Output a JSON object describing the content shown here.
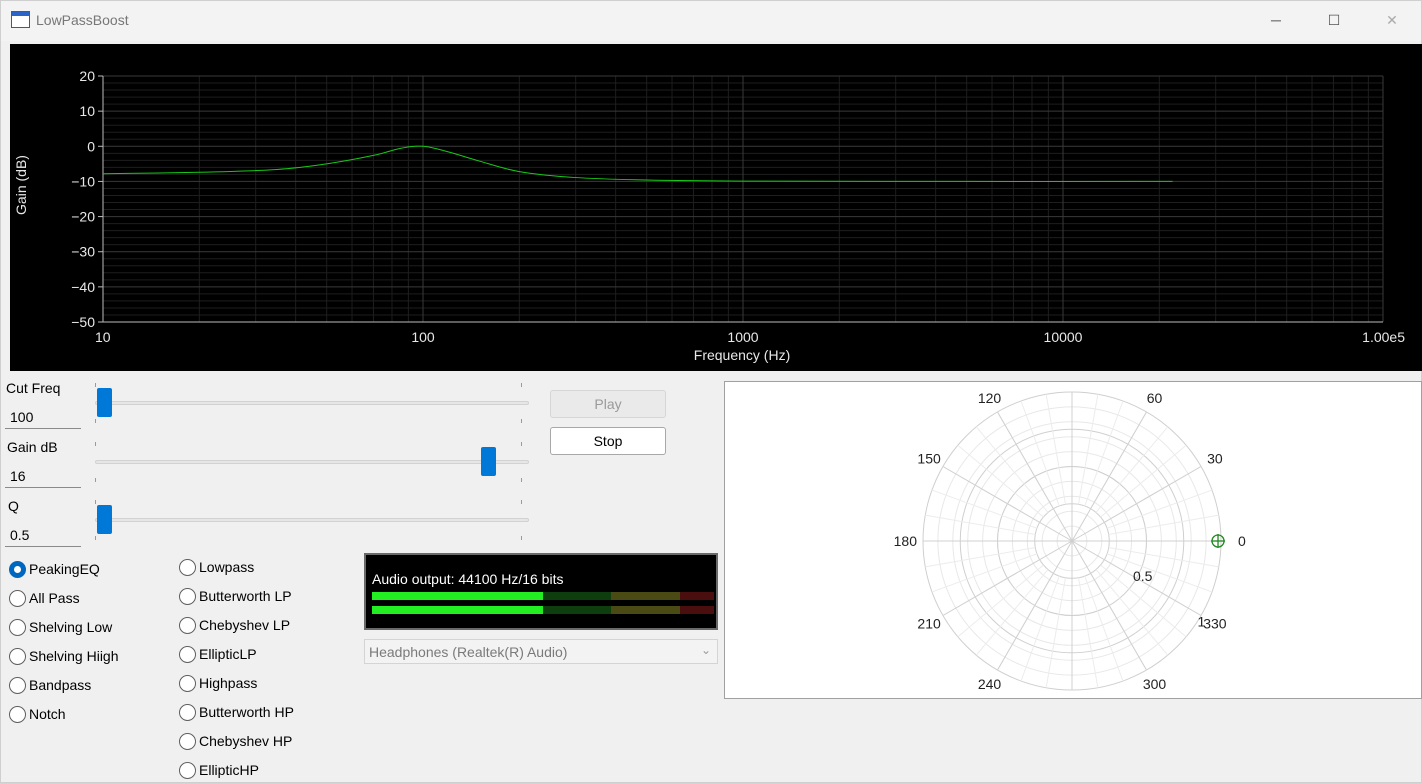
{
  "window": {
    "title": "LowPassBoost",
    "controls": {
      "minimize": "─",
      "maximize": "☐",
      "close": "✕"
    }
  },
  "chart_data": [
    {
      "type": "line",
      "title": "",
      "xlabel": "Frequency (Hz)",
      "ylabel": "Gain (dB)",
      "x_scale": "log",
      "xlim": [
        10,
        100000
      ],
      "ylim": [
        -50,
        20
      ],
      "x_tick_labels": [
        "10",
        "100",
        "1000",
        "10000",
        "1.00e5"
      ],
      "y_tick_labels": [
        "20",
        "10",
        "0",
        "−10",
        "−20",
        "−30",
        "−40",
        "−50"
      ],
      "grid": true,
      "background": "#000000",
      "series": [
        {
          "color": "#18c818",
          "x": [
            10,
            20,
            35,
            50,
            70,
            85,
            100,
            120,
            150,
            200,
            300,
            500,
            1000,
            5000,
            22000
          ],
          "y": [
            -7.8,
            -7.4,
            -6.6,
            -5.0,
            -2.6,
            -0.6,
            0.0,
            -1.6,
            -4.2,
            -7.2,
            -8.9,
            -9.6,
            -9.9,
            -10.0,
            -10.0
          ]
        }
      ]
    },
    {
      "type": "scatter",
      "subtype": "polar",
      "title": "",
      "angle_tick_labels": [
        "0",
        "30",
        "60",
        "120",
        "150",
        "180",
        "210",
        "240",
        "300",
        "330"
      ],
      "radius_tick_labels": [
        "0.5",
        "1"
      ],
      "rlim": [
        0,
        1
      ],
      "grid": true,
      "background": "#ffffff",
      "series": [
        {
          "marker": "circle-cross",
          "color": "#208820",
          "angle_deg": [
            0
          ],
          "r": [
            0.98
          ]
        }
      ]
    }
  ],
  "controls": {
    "cut_freq": {
      "label": "Cut Freq",
      "value": "100",
      "slider_fraction": 0.0
    },
    "gain_db": {
      "label": "Gain dB",
      "value": "16",
      "slider_fraction": 0.89
    },
    "q": {
      "label": "Q",
      "value": "0.5",
      "slider_fraction": 0.0
    }
  },
  "buttons": {
    "play": "Play",
    "stop": "Stop"
  },
  "filter_types_left": [
    {
      "label": "PeakingEQ",
      "selected": true
    },
    {
      "label": "All Pass",
      "selected": false
    },
    {
      "label": "Shelving Low",
      "selected": false
    },
    {
      "label": "Shelving Hiigh",
      "selected": false
    },
    {
      "label": "Bandpass",
      "selected": false
    },
    {
      "label": "Notch",
      "selected": false
    }
  ],
  "filter_types_right": [
    {
      "label": "Lowpass",
      "selected": false
    },
    {
      "label": "Butterworth LP",
      "selected": false
    },
    {
      "label": "Chebyshev LP",
      "selected": false
    },
    {
      "label": "EllipticLP",
      "selected": false
    },
    {
      "label": "Highpass",
      "selected": false
    },
    {
      "label": "Butterworth HP",
      "selected": false
    },
    {
      "label": "Chebyshev HP",
      "selected": false
    },
    {
      "label": "EllipticHP",
      "selected": false
    }
  ],
  "audio": {
    "status": "Audio output: 44100 Hz/16 bits",
    "meter_levels": [
      0.5,
      0.5
    ],
    "colors": {
      "active": "#22ee22",
      "green_dim": "#0e3e0e",
      "yellow_dim": "#4a4a14",
      "red_dim": "#4a0e0e"
    }
  },
  "device": {
    "selected": "Headphones (Realtek(R) Audio)"
  }
}
